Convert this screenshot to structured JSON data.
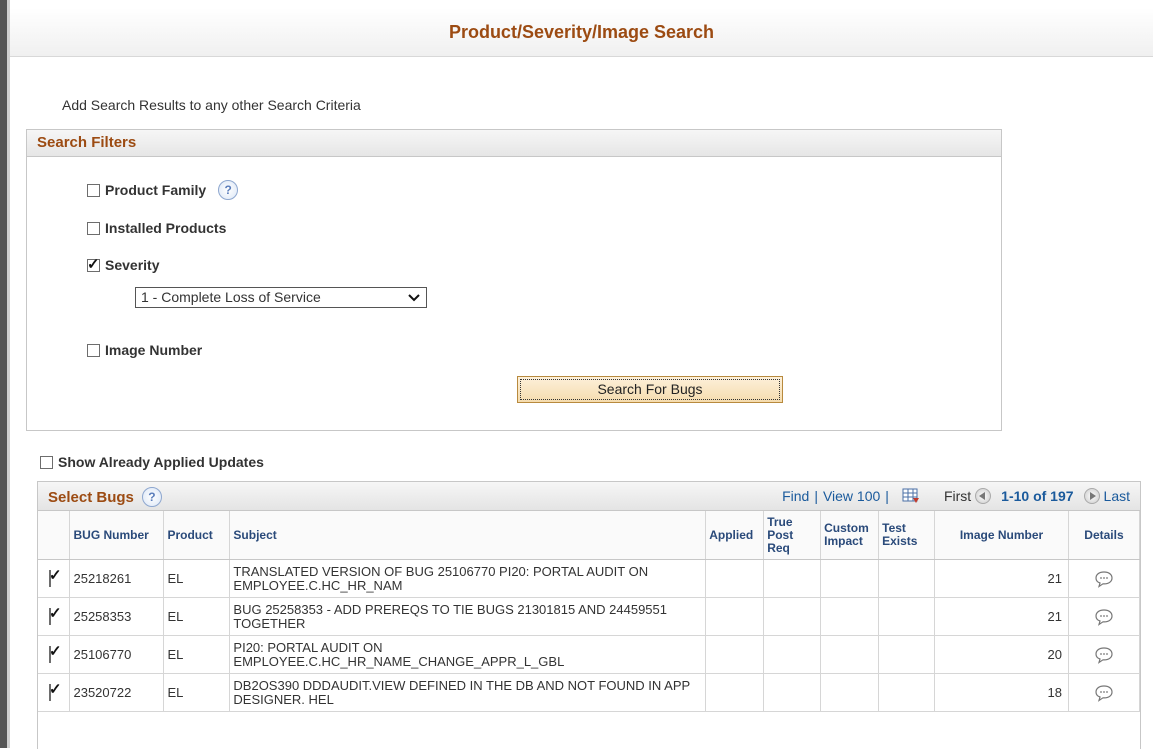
{
  "page": {
    "title": "Product/Severity/Image Search",
    "intro": "Add Search Results to any other Search Criteria"
  },
  "filters": {
    "heading": "Search Filters",
    "product_family": {
      "label": "Product Family",
      "checked": false
    },
    "installed_products": {
      "label": "Installed Products",
      "checked": false
    },
    "severity": {
      "label": "Severity",
      "checked": true,
      "selected": "1 - Complete Loss of Service"
    },
    "image_number": {
      "label": "Image Number",
      "checked": false
    },
    "search_button": "Search For Bugs"
  },
  "show_applied": {
    "label": "Show Already Applied Updates",
    "checked": false
  },
  "grid": {
    "title": "Select Bugs",
    "find": "Find",
    "view": "View 100",
    "first": "First",
    "range": "1-10 of 197",
    "last": "Last",
    "columns": {
      "bug_number": "BUG Number",
      "product": "Product",
      "subject": "Subject",
      "applied": "Applied",
      "true_post_req": "True Post Req",
      "custom_impact": "Custom Impact",
      "test_exists": "Test Exists",
      "image_number": "Image Number",
      "details": "Details"
    },
    "rows": [
      {
        "checked": true,
        "bug": "25218261",
        "product": "EL",
        "subject": "TRANSLATED VERSION OF BUG 25106770 PI20: PORTAL AUDIT ON EMPLOYEE.C.HC_HR_NAM",
        "image": "21"
      },
      {
        "checked": true,
        "bug": "25258353",
        "product": "EL",
        "subject": "BUG 25258353 - ADD PREREQS TO TIE BUGS 21301815 AND 24459551 TOGETHER",
        "image": "21"
      },
      {
        "checked": true,
        "bug": "25106770",
        "product": "EL",
        "subject": "PI20: PORTAL AUDIT ON EMPLOYEE.C.HC_HR_NAME_CHANGE_APPR_L_GBL",
        "image": "20"
      },
      {
        "checked": true,
        "bug": "23520722",
        "product": "EL",
        "subject": "DB2OS390 DDDAUDIT.VIEW DEFINED IN THE DB AND NOT FOUND IN APP DESIGNER. HEL",
        "image": "18"
      }
    ]
  },
  "colors": {
    "accent": "#9c4b12",
    "link": "#1a5a9c"
  }
}
